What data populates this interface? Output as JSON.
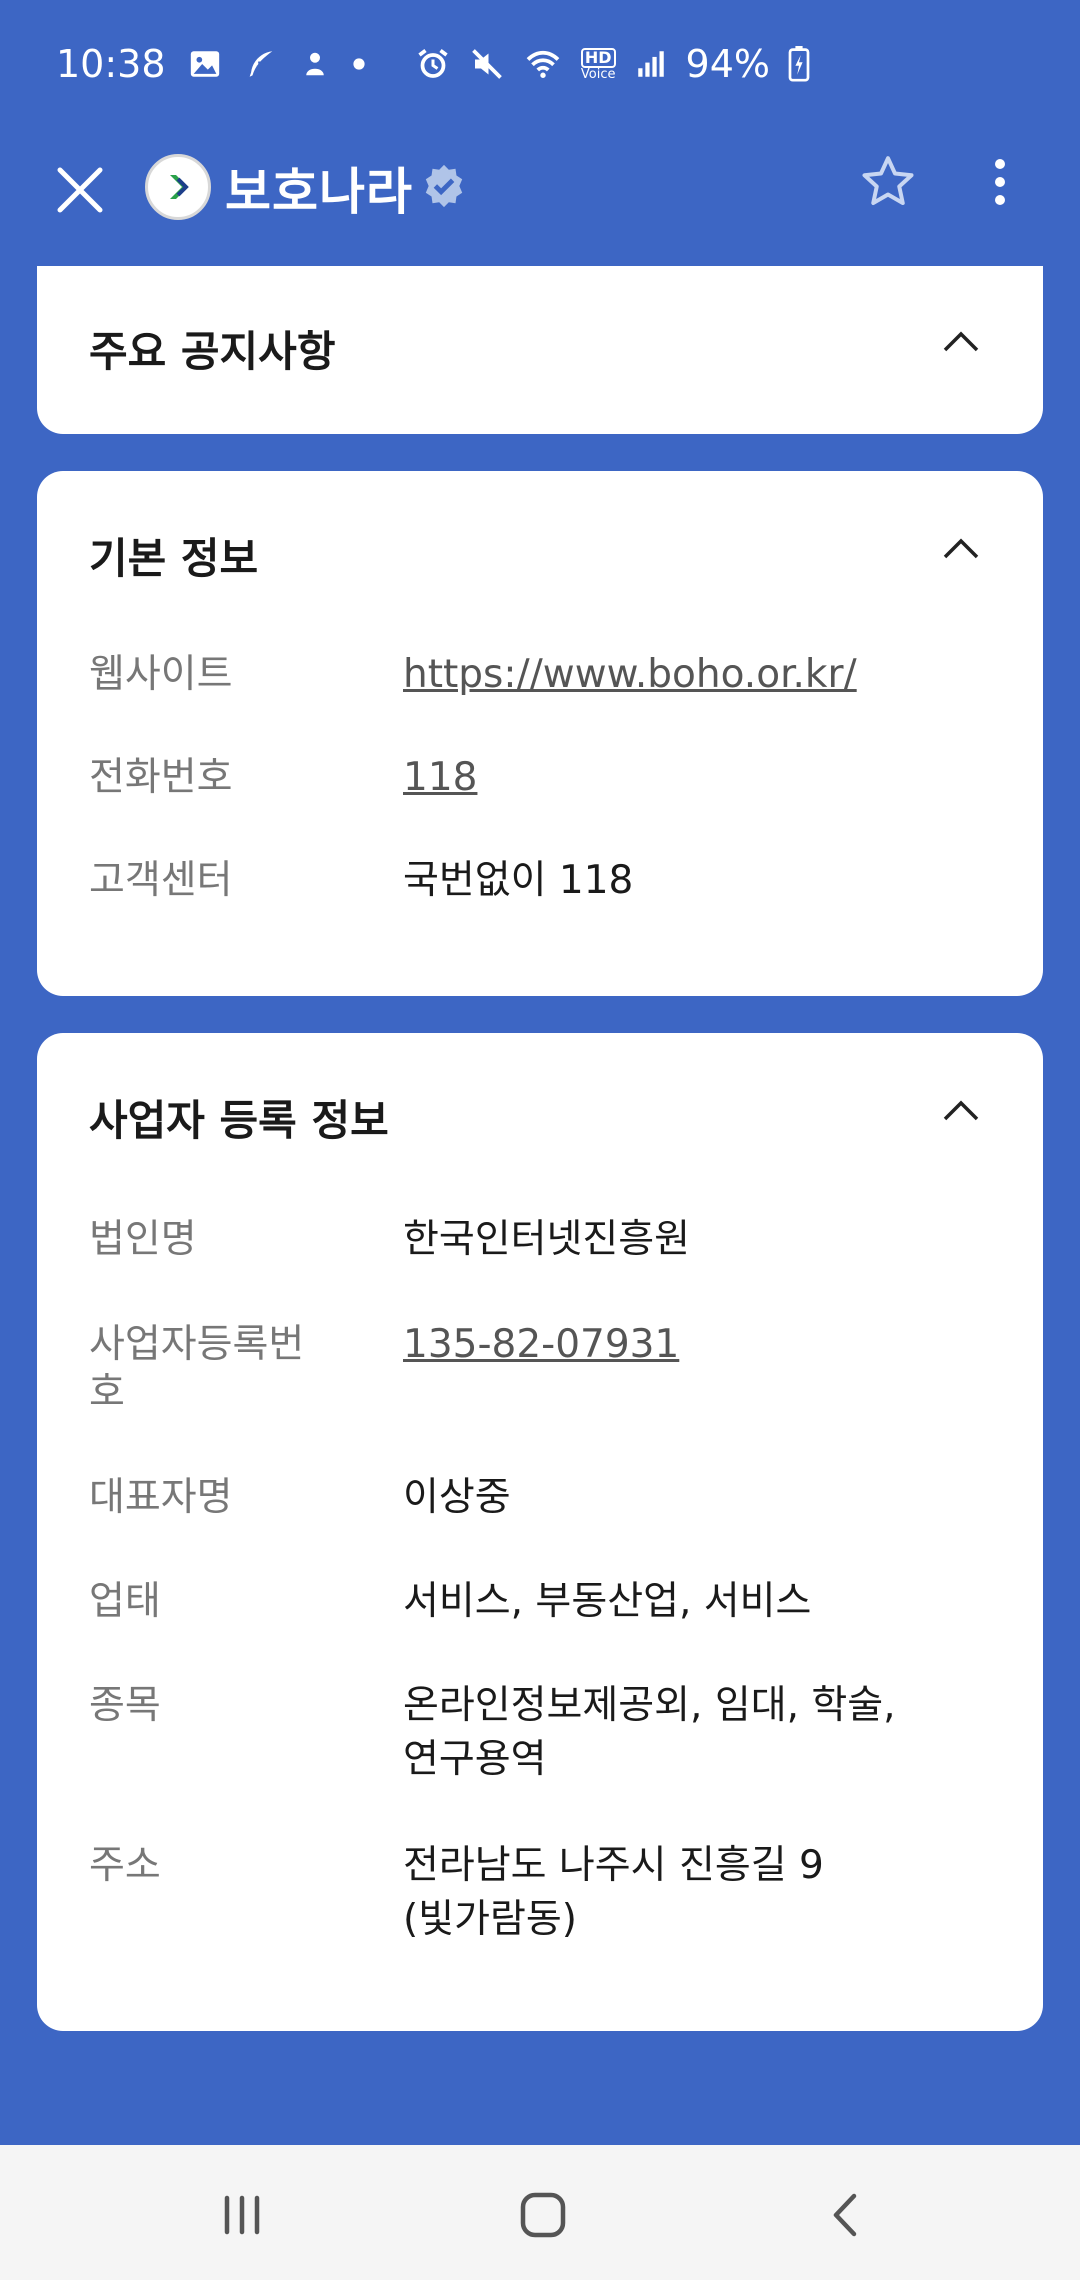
{
  "status_bar": {
    "time": "10:38",
    "battery": "94%",
    "hd_label": "HD",
    "voice_label": "Voice"
  },
  "header": {
    "title": "보호나라"
  },
  "sections": {
    "notice": {
      "title": "주요 공지사항"
    },
    "basic": {
      "title": "기본 정보",
      "rows": [
        {
          "label": "웹사이트",
          "value": "https://www.boho.or.kr/"
        },
        {
          "label": "전화번호",
          "value": "118"
        },
        {
          "label": "고객센터",
          "value": "국번없이 118"
        }
      ]
    },
    "business": {
      "title": "사업자 등록 정보",
      "rows": [
        {
          "label": "법인명",
          "value": "한국인터넷진흥원"
        },
        {
          "label": "사업자등록번호",
          "value": "135-82-07931"
        },
        {
          "label": "대표자명",
          "value": "이상중"
        },
        {
          "label": "업태",
          "value": "서비스, 부동산업, 서비스"
        },
        {
          "label": "종목",
          "value": "온라인정보제공외, 임대, 학술, 연구용역"
        },
        {
          "label": "주소",
          "value": "전라남도 나주시 진흥길 9 (빛가람동)"
        }
      ]
    }
  },
  "colors": {
    "background": "#3d66c4",
    "card": "#ffffff",
    "label": "#777777",
    "verified_badge": "#b0c4e8"
  },
  "icons": [
    "close-icon",
    "verified-badge-icon",
    "star-icon",
    "more-vert-icon",
    "chevron-up-icon",
    "recents-icon",
    "home-icon",
    "back-icon"
  ]
}
